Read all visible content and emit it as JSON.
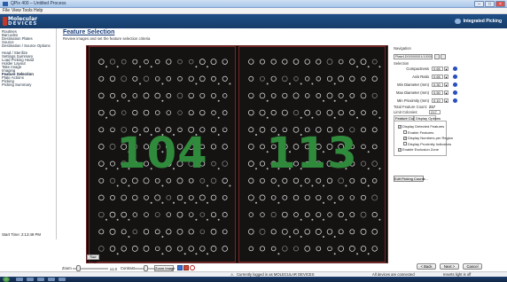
{
  "window": {
    "title": "QPix 400 – Untitled Process"
  },
  "menu": [
    "File",
    "View",
    "Tools",
    "Help"
  ],
  "header": {
    "logo_line1": "Molecular",
    "logo_line2": "DEVICES",
    "right_text": "Integrated Picking"
  },
  "sidebar": {
    "items": [
      "Routines",
      "Barcodes",
      "Destination Plates",
      "Source",
      "Destination / Source Options",
      "Head / Sterilize",
      "Settings Summary",
      "Load Picking Head",
      "Holder Layout",
      "Take Image",
      "Imaging",
      "Feature Selection",
      "Plate Actions",
      "Picking",
      "Picking Summary"
    ],
    "active_index": 11
  },
  "page": {
    "title": "Feature Selection",
    "subtitle": "Review images and set the feature selection criteria"
  },
  "plates": [
    {
      "count_label": "104"
    },
    {
      "count_label": "113"
    }
  ],
  "navigation": {
    "group": "Navigation",
    "selected": "Plate1D00000001/1000000"
  },
  "selection": {
    "group": "Selection",
    "params": [
      {
        "label": "Compactness",
        "value": "0.65"
      },
      {
        "label": "Axis Ratio",
        "value": "0.65"
      },
      {
        "label": "Min Diameter (mm)",
        "value": "0.30"
      },
      {
        "label": "Max Diameter (mm)",
        "value": "0.50"
      },
      {
        "label": "Min Proximity (mm)",
        "value": "0.10"
      }
    ],
    "total_label": "Total Feature Count:",
    "total_value": "217",
    "limit_label": "Limit Colonies:",
    "limit_value": "217"
  },
  "tabs": {
    "items": [
      "Feature Counts",
      "Display Options"
    ],
    "selected": 1
  },
  "display_options": [
    {
      "label": "Display Detected Features",
      "checked": true
    },
    {
      "label": "Enable Features",
      "checked": false
    },
    {
      "label": "Display Numbers per Region",
      "checked": true
    },
    {
      "label": "Display Proximity Indicators",
      "checked": false
    },
    {
      "label": "Enable Exclusion Zone",
      "checked": true
    }
  ],
  "buttons": {
    "edit_picking_counts": "Edit Picking Counts...",
    "back": "< Back",
    "next": "Next >",
    "cancel": "Cancel",
    "zoom_image": "Zoom Image"
  },
  "zoom": {
    "label": "Zoom",
    "value": "x1.0",
    "contrast_label": "Contrast"
  },
  "image_tag": "Raw Image",
  "start_time": "Start Time: 2:13:49 PM",
  "status": {
    "message": "Currently logged in as MOLECULAR DEVICES",
    "connected": "All devices are connected",
    "logout": "Inserts light is off"
  },
  "colors": {
    "header": "#1e4f86",
    "plate_number": "#2f8a3c",
    "plate_border": "#7a2727"
  },
  "plate_grid": {
    "rows": 12,
    "cols": 12
  }
}
